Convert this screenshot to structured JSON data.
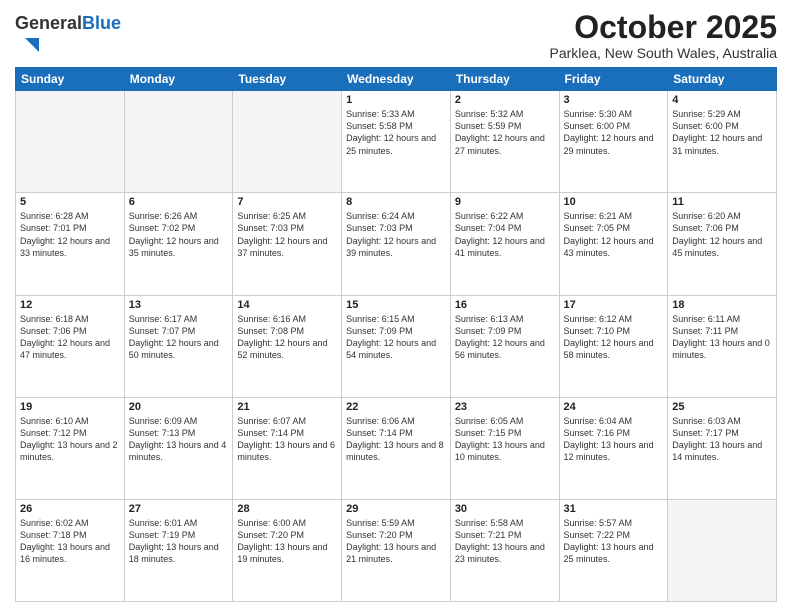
{
  "logo": {
    "general": "General",
    "blue": "Blue"
  },
  "header": {
    "month": "October 2025",
    "location": "Parklea, New South Wales, Australia"
  },
  "weekdays": [
    "Sunday",
    "Monday",
    "Tuesday",
    "Wednesday",
    "Thursday",
    "Friday",
    "Saturday"
  ],
  "weeks": [
    [
      {
        "day": "",
        "empty": true
      },
      {
        "day": "",
        "empty": true
      },
      {
        "day": "",
        "empty": true
      },
      {
        "day": "1",
        "sunrise": "5:33 AM",
        "sunset": "5:58 PM",
        "daylight": "12 hours and 25 minutes."
      },
      {
        "day": "2",
        "sunrise": "5:32 AM",
        "sunset": "5:59 PM",
        "daylight": "12 hours and 27 minutes."
      },
      {
        "day": "3",
        "sunrise": "5:30 AM",
        "sunset": "6:00 PM",
        "daylight": "12 hours and 29 minutes."
      },
      {
        "day": "4",
        "sunrise": "5:29 AM",
        "sunset": "6:00 PM",
        "daylight": "12 hours and 31 minutes."
      }
    ],
    [
      {
        "day": "5",
        "sunrise": "6:28 AM",
        "sunset": "7:01 PM",
        "daylight": "12 hours and 33 minutes."
      },
      {
        "day": "6",
        "sunrise": "6:26 AM",
        "sunset": "7:02 PM",
        "daylight": "12 hours and 35 minutes."
      },
      {
        "day": "7",
        "sunrise": "6:25 AM",
        "sunset": "7:03 PM",
        "daylight": "12 hours and 37 minutes."
      },
      {
        "day": "8",
        "sunrise": "6:24 AM",
        "sunset": "7:03 PM",
        "daylight": "12 hours and 39 minutes."
      },
      {
        "day": "9",
        "sunrise": "6:22 AM",
        "sunset": "7:04 PM",
        "daylight": "12 hours and 41 minutes."
      },
      {
        "day": "10",
        "sunrise": "6:21 AM",
        "sunset": "7:05 PM",
        "daylight": "12 hours and 43 minutes."
      },
      {
        "day": "11",
        "sunrise": "6:20 AM",
        "sunset": "7:06 PM",
        "daylight": "12 hours and 45 minutes."
      }
    ],
    [
      {
        "day": "12",
        "sunrise": "6:18 AM",
        "sunset": "7:06 PM",
        "daylight": "12 hours and 47 minutes."
      },
      {
        "day": "13",
        "sunrise": "6:17 AM",
        "sunset": "7:07 PM",
        "daylight": "12 hours and 50 minutes."
      },
      {
        "day": "14",
        "sunrise": "6:16 AM",
        "sunset": "7:08 PM",
        "daylight": "12 hours and 52 minutes."
      },
      {
        "day": "15",
        "sunrise": "6:15 AM",
        "sunset": "7:09 PM",
        "daylight": "12 hours and 54 minutes."
      },
      {
        "day": "16",
        "sunrise": "6:13 AM",
        "sunset": "7:09 PM",
        "daylight": "12 hours and 56 minutes."
      },
      {
        "day": "17",
        "sunrise": "6:12 AM",
        "sunset": "7:10 PM",
        "daylight": "12 hours and 58 minutes."
      },
      {
        "day": "18",
        "sunrise": "6:11 AM",
        "sunset": "7:11 PM",
        "daylight": "13 hours and 0 minutes."
      }
    ],
    [
      {
        "day": "19",
        "sunrise": "6:10 AM",
        "sunset": "7:12 PM",
        "daylight": "13 hours and 2 minutes."
      },
      {
        "day": "20",
        "sunrise": "6:09 AM",
        "sunset": "7:13 PM",
        "daylight": "13 hours and 4 minutes."
      },
      {
        "day": "21",
        "sunrise": "6:07 AM",
        "sunset": "7:14 PM",
        "daylight": "13 hours and 6 minutes."
      },
      {
        "day": "22",
        "sunrise": "6:06 AM",
        "sunset": "7:14 PM",
        "daylight": "13 hours and 8 minutes."
      },
      {
        "day": "23",
        "sunrise": "6:05 AM",
        "sunset": "7:15 PM",
        "daylight": "13 hours and 10 minutes."
      },
      {
        "day": "24",
        "sunrise": "6:04 AM",
        "sunset": "7:16 PM",
        "daylight": "13 hours and 12 minutes."
      },
      {
        "day": "25",
        "sunrise": "6:03 AM",
        "sunset": "7:17 PM",
        "daylight": "13 hours and 14 minutes."
      }
    ],
    [
      {
        "day": "26",
        "sunrise": "6:02 AM",
        "sunset": "7:18 PM",
        "daylight": "13 hours and 16 minutes."
      },
      {
        "day": "27",
        "sunrise": "6:01 AM",
        "sunset": "7:19 PM",
        "daylight": "13 hours and 18 minutes."
      },
      {
        "day": "28",
        "sunrise": "6:00 AM",
        "sunset": "7:20 PM",
        "daylight": "13 hours and 19 minutes."
      },
      {
        "day": "29",
        "sunrise": "5:59 AM",
        "sunset": "7:20 PM",
        "daylight": "13 hours and 21 minutes."
      },
      {
        "day": "30",
        "sunrise": "5:58 AM",
        "sunset": "7:21 PM",
        "daylight": "13 hours and 23 minutes."
      },
      {
        "day": "31",
        "sunrise": "5:57 AM",
        "sunset": "7:22 PM",
        "daylight": "13 hours and 25 minutes."
      },
      {
        "day": "",
        "empty": true
      }
    ]
  ],
  "labels": {
    "sunrise": "Sunrise:",
    "sunset": "Sunset:",
    "daylight": "Daylight:"
  }
}
